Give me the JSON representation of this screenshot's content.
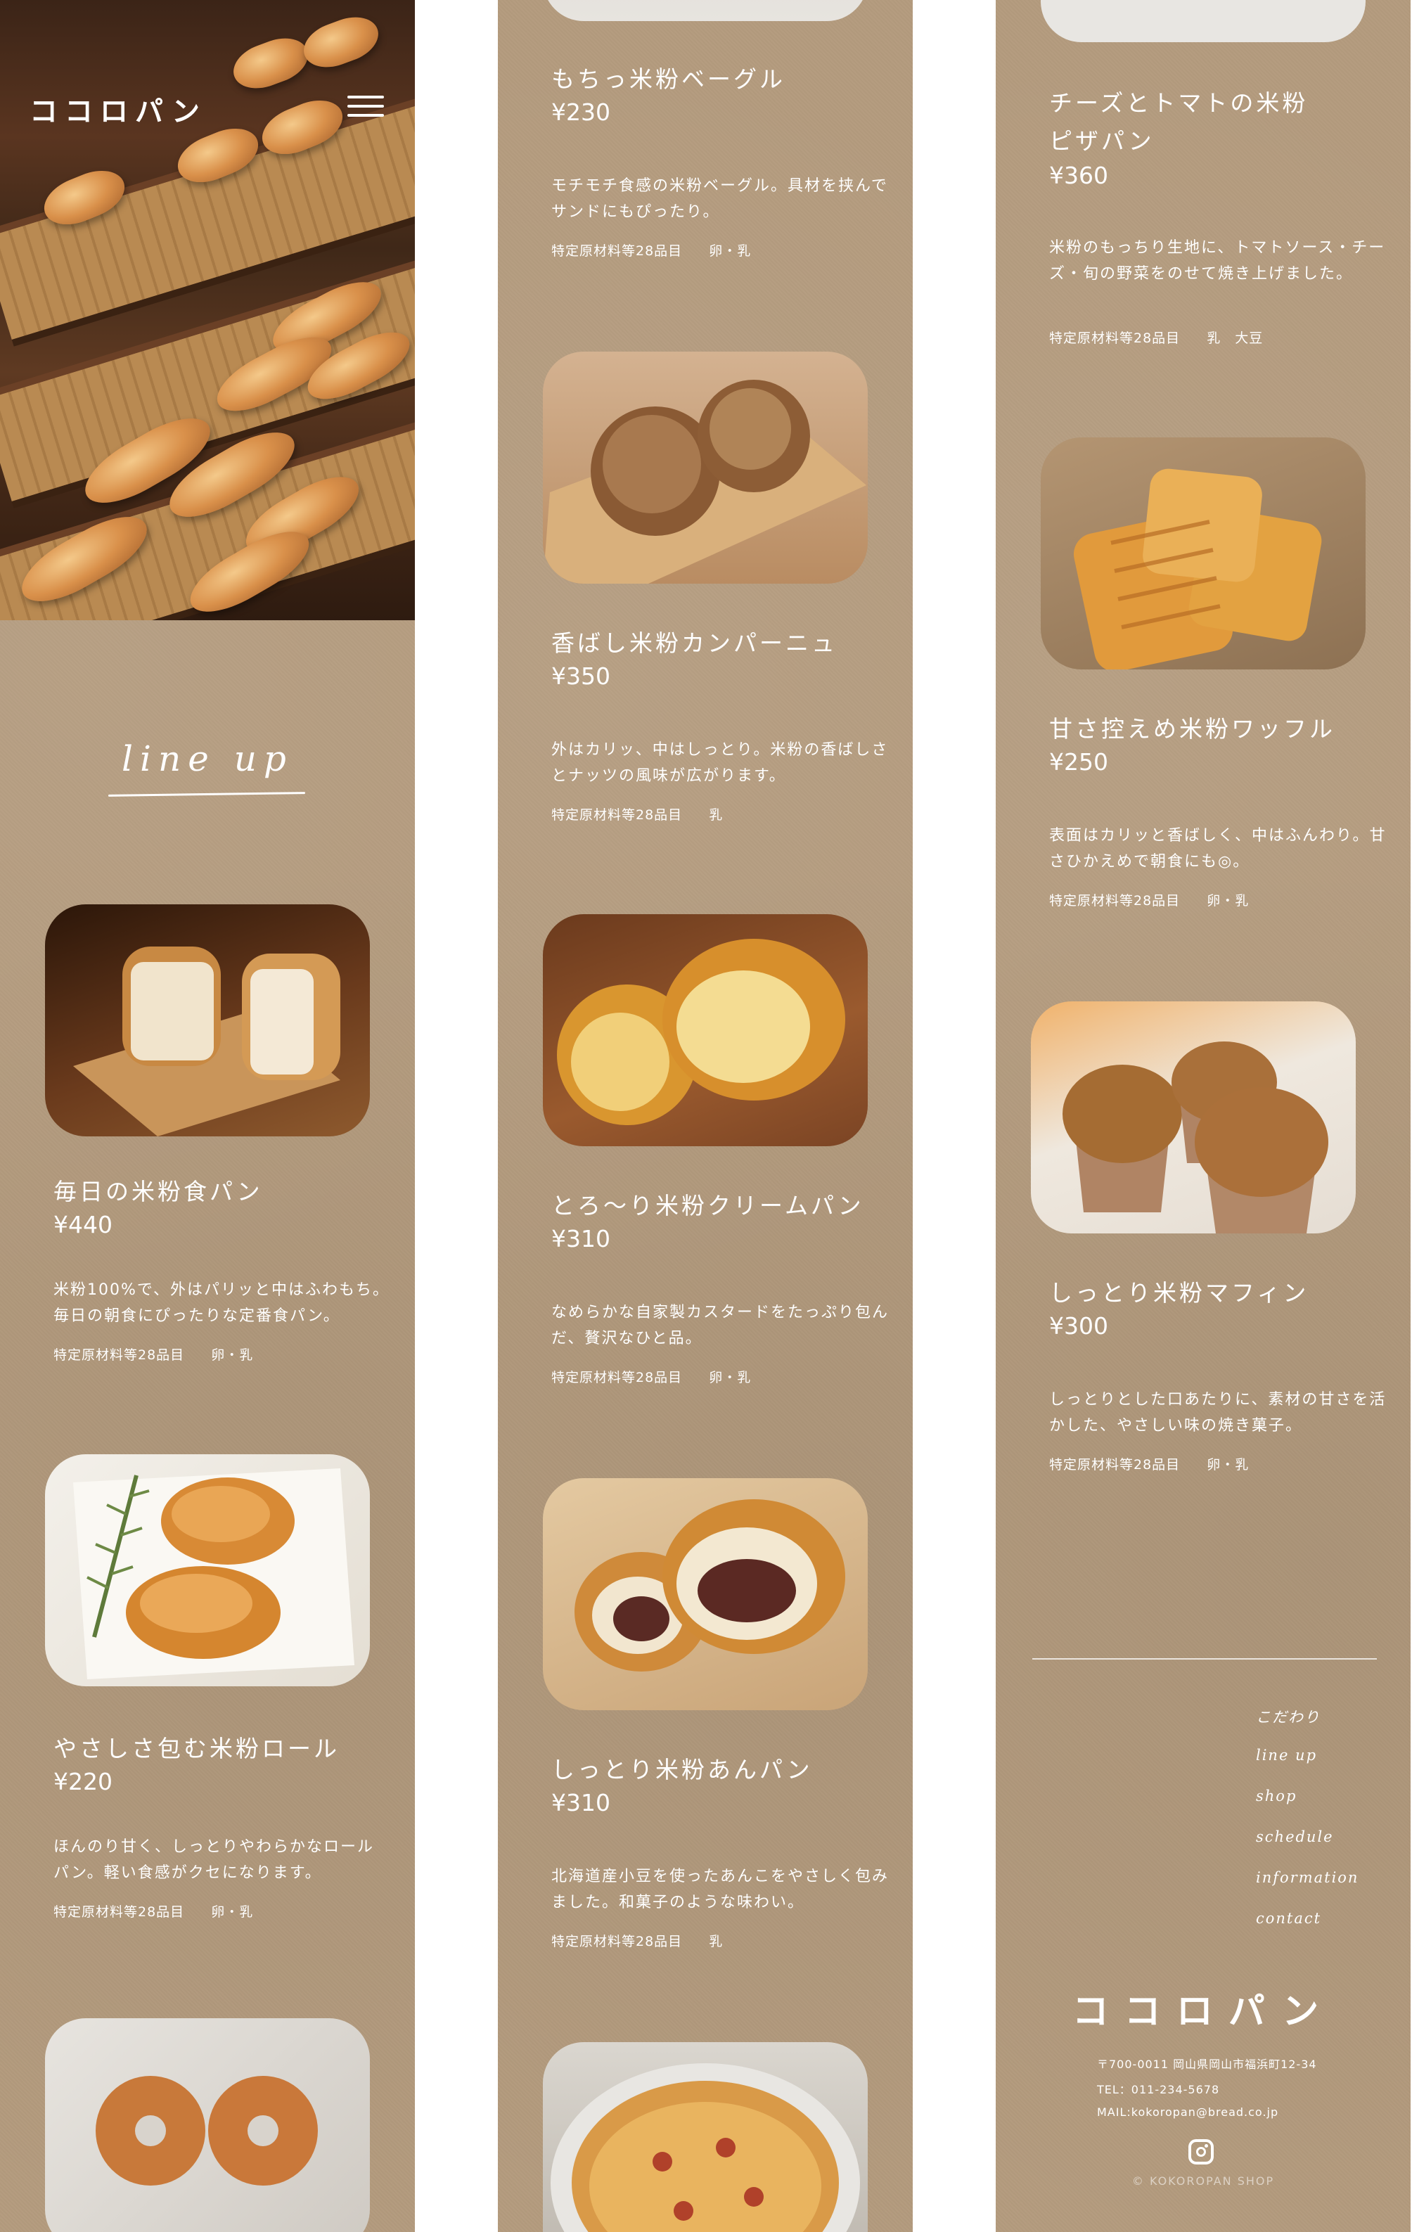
{
  "brand": {
    "logo": "ココロパン"
  },
  "section": {
    "title": "line up"
  },
  "products": [
    {
      "name": "毎日の米粉食パン",
      "price": "¥440",
      "desc": "米粉100%で、外はパリッと中はふわもち。毎日の朝食にぴったりな定番食パン。",
      "allergen_label": "特定原材料等28品目",
      "allergens": "卵・乳",
      "image": "rice-flour-bread-loaf"
    },
    {
      "name": "やさしさ包む米粉ロール",
      "price": "¥220",
      "desc": "ほんのり甘く、しっとりやわらかなロールパン。軽い食感がクセになります。",
      "allergen_label": "特定原材料等28品目",
      "allergens": "卵・乳",
      "image": "rice-flour-rolls"
    },
    {
      "name": "もちっ米粉ベーグル",
      "price": "¥230",
      "desc": "モチモチ食感の米粉ベーグル。具材を挟んでサンドにもぴったり。",
      "allergen_label": "特定原材料等28品目",
      "allergens": "卵・乳",
      "image": "rice-flour-bagels"
    },
    {
      "name": "香ばし米粉カンパーニュ",
      "price": "¥350",
      "desc": "外はカリッ、中はしっとり。米粉の香ばしさとナッツの風味が広がります。",
      "allergen_label": "特定原材料等28品目",
      "allergens": "乳",
      "image": "campagne"
    },
    {
      "name": "とろ～り米粉クリームパン",
      "price": "¥310",
      "desc": "なめらかな自家製カスタードをたっぷり包んだ、贅沢なひと品。",
      "allergen_label": "特定原材料等28品目",
      "allergens": "卵・乳",
      "image": "cream-bun"
    },
    {
      "name": "しっとり米粉あんパン",
      "price": "¥310",
      "desc": "北海道産小豆を使ったあんこをやさしく包みました。和菓子のような味わい。",
      "allergen_label": "特定原材料等28品目",
      "allergens": "乳",
      "image": "anpan"
    },
    {
      "name_line1": "チーズとトマトの米粉",
      "name_line2": "ピザパン",
      "price": "¥360",
      "desc": "米粉のもっちり生地に、トマトソース・チーズ・旬の野菜をのせて焼き上げました。",
      "allergen_label": "特定原材料等28品目",
      "allergens": "乳　大豆",
      "image": "pizza-bread"
    },
    {
      "name": "甘さ控えめ米粉ワッフル",
      "price": "¥250",
      "desc": "表面はカリッと香ばしく、中はふんわり。甘さひかえめで朝食にも◎。",
      "allergen_label": "特定原材料等28品目",
      "allergens": "卵・乳",
      "image": "waffles"
    },
    {
      "name": "しっとり米粉マフィン",
      "price": "¥300",
      "desc": "しっとりとした口あたりに、素材の甘さを活かした、やさしい味の焼き菓子。",
      "allergen_label": "特定原材料等28品目",
      "allergens": "卵・乳",
      "image": "muffins"
    }
  ],
  "footer": {
    "nav": [
      "こだわり",
      "line up",
      "shop",
      "schedule",
      "information",
      "contact"
    ],
    "logo": "ココロパン",
    "address": "〒700-0011 岡山県岡山市福浜町12-34",
    "tel": "TEL：011-234-5678",
    "mail": "MAIL:kokoropan@bread.co.jp",
    "copyright": "© KOKOROPAN SHOP"
  },
  "icons": {
    "menu": "hamburger-menu-icon",
    "social": "instagram-icon"
  },
  "colors": {
    "background": "#b49b7e",
    "text": "#ffffff"
  }
}
